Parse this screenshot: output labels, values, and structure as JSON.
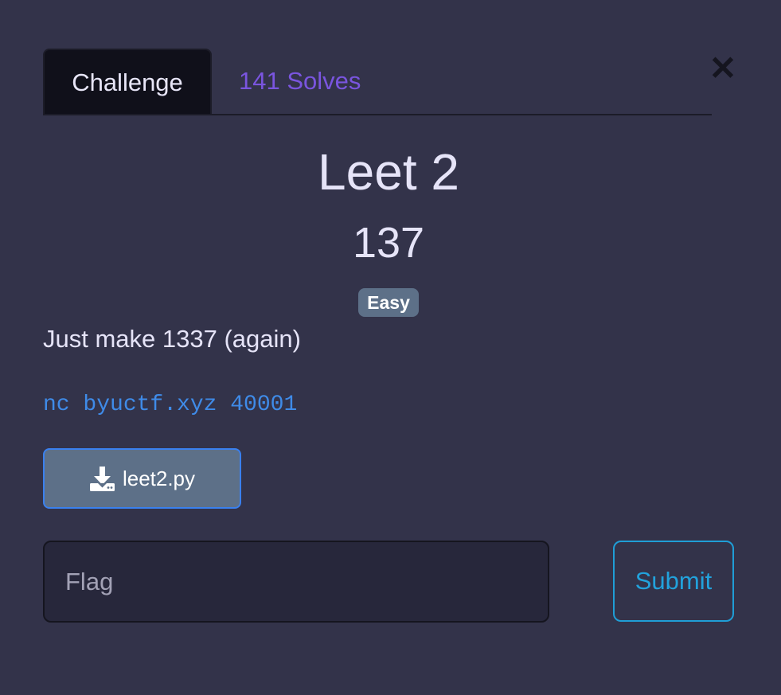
{
  "tabs": {
    "challenge_label": "Challenge",
    "solves_label": "141 Solves"
  },
  "close_glyph": "✕",
  "challenge": {
    "name": "Leet 2",
    "points": "137",
    "difficulty": "Easy",
    "description": "Just make 1337 (again)",
    "connection": "nc byuctf.xyz 40001"
  },
  "file": {
    "icon": "download-icon",
    "name": "leet2.py"
  },
  "flag_input": {
    "placeholder": "Flag",
    "value": ""
  },
  "submit_label": "Submit",
  "colors": {
    "background": "#33334a",
    "active_tab": "#10101a",
    "solves_link": "#7a55df",
    "badge": "#5d7088",
    "connection_text": "#3f8be8",
    "submit_border": "#1f9ed6"
  }
}
